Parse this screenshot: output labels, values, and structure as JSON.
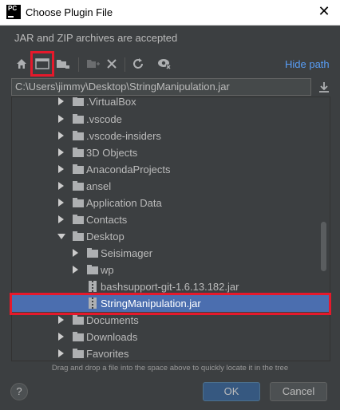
{
  "window": {
    "title": "Choose Plugin File",
    "close_glyph": "✕",
    "app_logo_text": "PC"
  },
  "subtitle": "JAR and ZIP archives are accepted",
  "toolbar": {
    "buttons": [
      "home-icon",
      "desktop-icon",
      "new-folder-icon",
      "refresh-module-icon",
      "delete-icon",
      "refresh-icon",
      "show-hidden-icon"
    ],
    "hide_path_label": "Hide path"
  },
  "path": {
    "value": "C:\\Users\\jimmy\\Desktop\\StringManipulation.jar"
  },
  "tree": {
    "items": [
      {
        "label": ".VirtualBox",
        "type": "folder",
        "expanded": false
      },
      {
        "label": ".vscode",
        "type": "folder",
        "expanded": false
      },
      {
        "label": ".vscode-insiders",
        "type": "folder",
        "expanded": false
      },
      {
        "label": "3D Objects",
        "type": "folder",
        "expanded": false
      },
      {
        "label": "AnacondaProjects",
        "type": "folder",
        "expanded": false
      },
      {
        "label": "ansel",
        "type": "folder",
        "expanded": false
      },
      {
        "label": "Application Data",
        "type": "folder-link",
        "expanded": false
      },
      {
        "label": "Contacts",
        "type": "folder",
        "expanded": false
      },
      {
        "label": "Desktop",
        "type": "folder",
        "expanded": true
      },
      {
        "label": "Seisimager",
        "type": "folder",
        "expanded": false
      },
      {
        "label": "wp",
        "type": "folder",
        "expanded": false
      },
      {
        "label": "bashsupport-git-1.6.13.182.jar",
        "type": "jar"
      },
      {
        "label": "StringManipulation.jar",
        "type": "jar",
        "selected": true
      },
      {
        "label": "Documents",
        "type": "folder",
        "expanded": false
      },
      {
        "label": "Downloads",
        "type": "folder",
        "expanded": false
      },
      {
        "label": "Favorites",
        "type": "folder",
        "expanded": false
      }
    ]
  },
  "hint": "Drag and drop a file into the space above to quickly locate it in the tree",
  "buttons": {
    "help": "?",
    "ok": "OK",
    "cancel": "Cancel"
  },
  "colors": {
    "highlight": "#e6192b",
    "selection": "#4b6eaf",
    "link": "#589df6",
    "background": "#3c3f41"
  }
}
